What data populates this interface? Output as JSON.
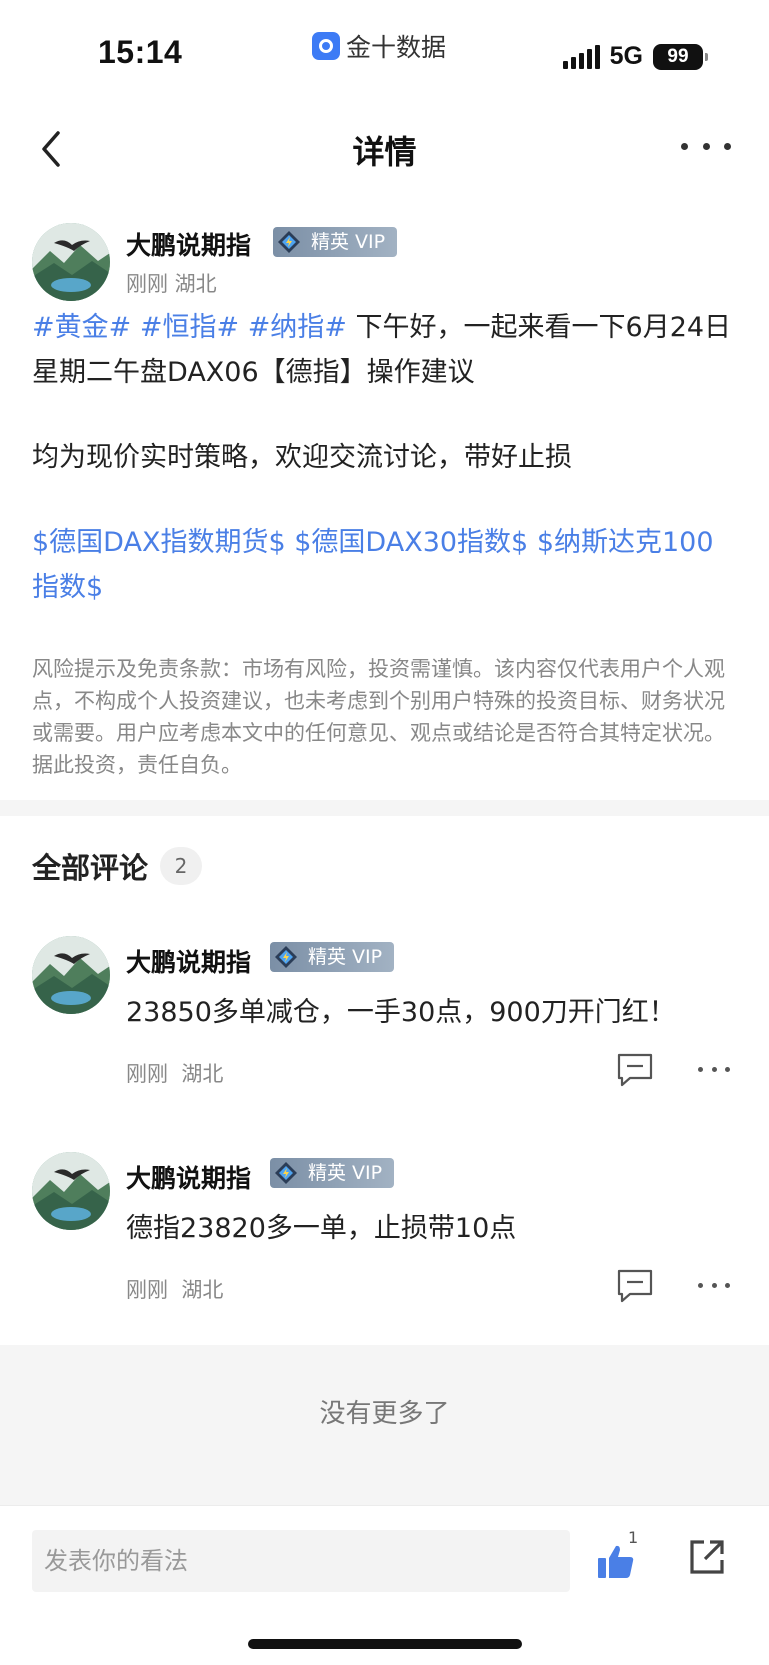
{
  "status_bar": {
    "time": "15:14",
    "app_label": "金十数据",
    "network": "5G",
    "battery": "99"
  },
  "nav": {
    "title": "详情",
    "back_icon": "chevron-left-icon",
    "more_icon": "more-dots-icon"
  },
  "post": {
    "author": "大鹏说期指",
    "badge": "精英 VIP",
    "meta": "刚刚 湖北",
    "hashtags": [
      "#黄金#",
      "#恒指#",
      "#纳指#"
    ],
    "text_line1": " 下午好，一起来看一下6月24日星期二午盘DAX06【德指】操作建议",
    "text_line2": "均为现价实时策略，欢迎交流讨论，带好止损",
    "stock_tags": [
      "$德国DAX指数期货$",
      "$德国DAX30指数$",
      "$纳斯达克100指数$"
    ],
    "disclaimer": "风险提示及免责条款：市场有风险，投资需谨慎。该内容仅代表用户个人观点，不构成个人投资建议，也未考虑到个别用户特殊的投资目标、财务状况或需要。用户应考虑本文中的任何意见、观点或结论是否符合其特定状况。据此投资，责任自负。"
  },
  "comments_section": {
    "title": "全部评论",
    "count": "2",
    "items": [
      {
        "author": "大鹏说期指",
        "badge": "精英 VIP",
        "text": "23850多单减仓，一手30点，900刀开门红！",
        "time": "刚刚",
        "location": "湖北"
      },
      {
        "author": "大鹏说期指",
        "badge": "精英 VIP",
        "text": "德指23820多一单，止损带10点",
        "time": "刚刚",
        "location": "湖北"
      }
    ],
    "no_more": "没有更多了"
  },
  "bottom_bar": {
    "input_placeholder": "发表你的看法",
    "like_count": "1",
    "like_icon": "thumbs-up-icon",
    "share_icon": "share-icon"
  },
  "colors": {
    "accent_blue": "#4a7fe6",
    "vip_badge": "#8a9bb0",
    "muted_text": "#888888"
  }
}
